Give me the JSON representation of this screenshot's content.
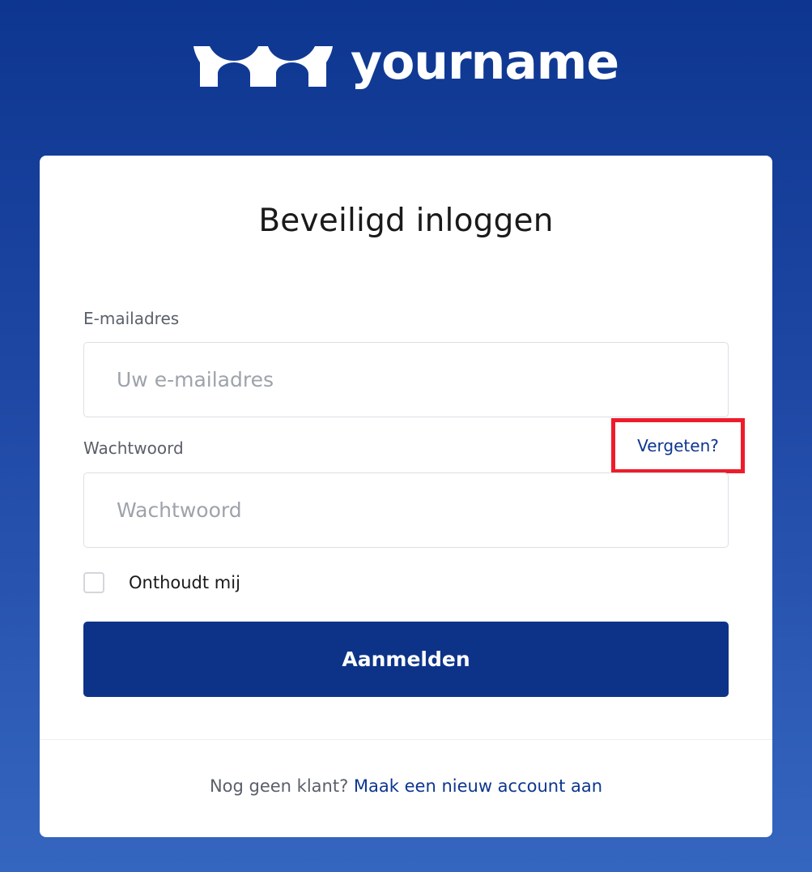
{
  "brand": {
    "name": "yourname",
    "logo_icon": "brand-logo-icon"
  },
  "login": {
    "title": "Beveiligd inloggen",
    "email_label": "E-mailadres",
    "email_placeholder": "Uw e-mailadres",
    "email_value": "",
    "password_label": "Wachtwoord",
    "password_placeholder": "Wachtwoord",
    "password_value": "",
    "forgot_label": "Vergeten?",
    "remember_label": "Onthoudt mij",
    "remember_checked": false,
    "submit_label": "Aanmelden"
  },
  "footer": {
    "prompt": "Nog geen klant?",
    "link_label": "Maak een nieuw account aan"
  },
  "colors": {
    "primary": "#0d3389",
    "link": "#0d3690",
    "highlight": "#ee1c2b"
  }
}
